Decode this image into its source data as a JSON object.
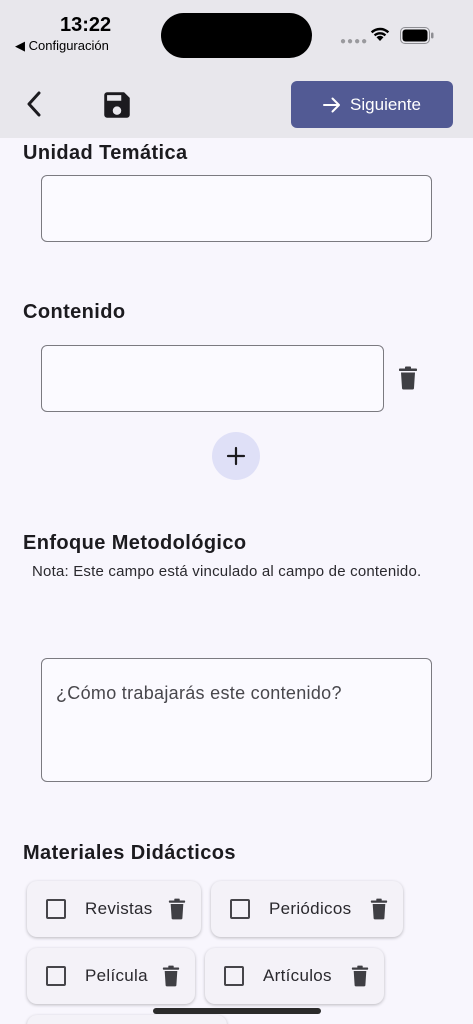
{
  "status_bar": {
    "time": "13:22",
    "back_app": "◀ Configuración"
  },
  "toolbar": {
    "next_label": "Siguiente"
  },
  "sections": {
    "unidad": {
      "title": "Unidad Temática"
    },
    "contenido": {
      "title": "Contenido"
    },
    "enfoque": {
      "title": "Enfoque Metodológico",
      "note": "Nota: Este campo está vinculado al campo de contenido.",
      "placeholder": "¿Cómo trabajarás este contenido?"
    },
    "materiales": {
      "title": "Materiales Didácticos",
      "items": [
        {
          "label": "Revistas",
          "checked": false
        },
        {
          "label": "Periódicos",
          "checked": false
        },
        {
          "label": "Película",
          "checked": false
        },
        {
          "label": "Artículos",
          "checked": false
        }
      ]
    }
  },
  "colors": {
    "primary": "#525a94",
    "app_bar": "#e8e7ec",
    "background": "#f8f6fd",
    "fab": "#dfe0f7"
  },
  "icons": [
    "back-icon",
    "save-icon",
    "arrow-right-icon",
    "trash-icon",
    "plus-icon",
    "wifi-icon",
    "battery-icon"
  ]
}
